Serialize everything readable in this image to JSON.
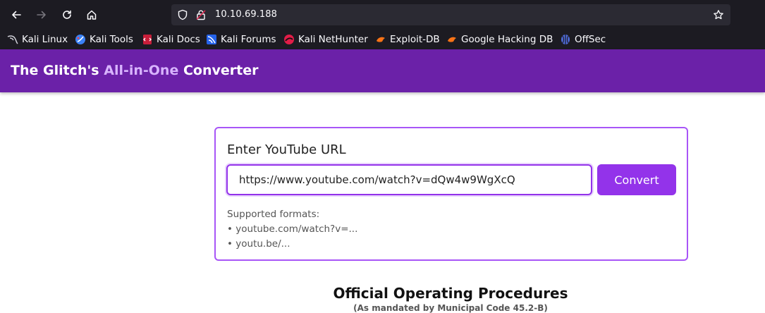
{
  "browser": {
    "url": "10.10.69.188",
    "bookmarks": [
      {
        "label": "Kali Linux",
        "icon": "kali-dragon-icon"
      },
      {
        "label": "Kali Tools",
        "icon": "kali-tools-icon"
      },
      {
        "label": "Kali Docs",
        "icon": "kali-docs-icon"
      },
      {
        "label": "Kali Forums",
        "icon": "kali-forums-icon"
      },
      {
        "label": "Kali NetHunter",
        "icon": "kali-nethunter-icon"
      },
      {
        "label": "Exploit-DB",
        "icon": "exploit-db-icon"
      },
      {
        "label": "Google Hacking DB",
        "icon": "ghdb-icon"
      },
      {
        "label": "OffSec",
        "icon": "offsec-icon"
      }
    ]
  },
  "header": {
    "title_pre": "The Glitch's ",
    "title_accent": "All-in-One",
    "title_post": " Converter"
  },
  "converter": {
    "label": "Enter YouTube URL",
    "url_value": "https://www.youtube.com/watch?v=dQw4w9WgXcQ",
    "button_label": "Convert",
    "formats_heading": "Supported formats:",
    "formats": [
      "youtube.com/watch?v=...",
      "youtu.be/..."
    ]
  },
  "procedures": {
    "title": "Official Operating Procedures",
    "subtitle": "(As mandated by Municipal Code 45.2-B)"
  },
  "colors": {
    "header_bg": "#6b21a8",
    "accent": "#9333ea",
    "accent_light": "#d8b4fe",
    "chrome_bg": "#1c1b22"
  }
}
